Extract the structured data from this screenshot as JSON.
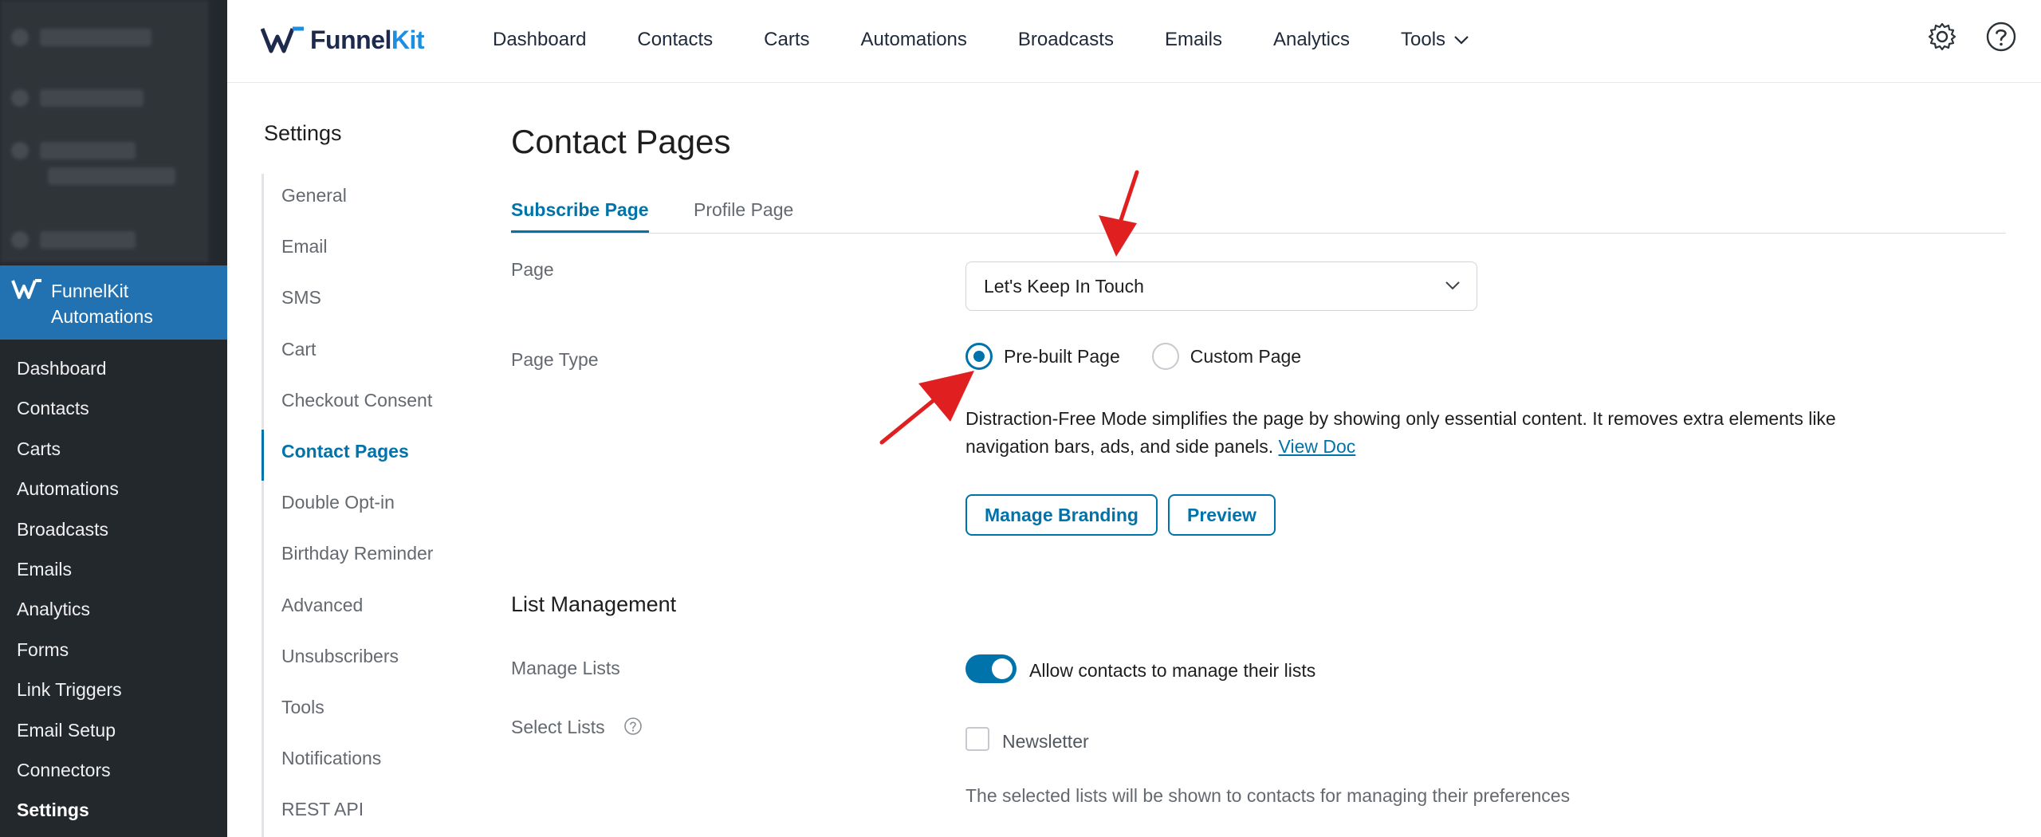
{
  "wp_sidebar": {
    "active_plugin": {
      "line1": "FunnelKit",
      "line2": "Automations"
    },
    "items": [
      {
        "label": "Dashboard"
      },
      {
        "label": "Contacts"
      },
      {
        "label": "Carts"
      },
      {
        "label": "Automations"
      },
      {
        "label": "Broadcasts"
      },
      {
        "label": "Emails"
      },
      {
        "label": "Analytics"
      },
      {
        "label": "Forms"
      },
      {
        "label": "Link Triggers"
      },
      {
        "label": "Email Setup"
      },
      {
        "label": "Connectors"
      },
      {
        "label": "Settings",
        "active": true
      }
    ]
  },
  "header": {
    "logo": {
      "part1": "Funnel",
      "part2": "Kit"
    },
    "nav": [
      {
        "label": "Dashboard"
      },
      {
        "label": "Contacts"
      },
      {
        "label": "Carts"
      },
      {
        "label": "Automations"
      },
      {
        "label": "Broadcasts"
      },
      {
        "label": "Emails"
      },
      {
        "label": "Analytics"
      },
      {
        "label": "Tools",
        "has_dropdown": true
      }
    ],
    "icons": [
      "gear-icon",
      "help-icon"
    ]
  },
  "settings_nav": {
    "title": "Settings",
    "items": [
      {
        "label": "General"
      },
      {
        "label": "Email"
      },
      {
        "label": "SMS"
      },
      {
        "label": "Cart"
      },
      {
        "label": "Checkout Consent"
      },
      {
        "label": "Contact Pages",
        "active": true
      },
      {
        "label": "Double Opt-in"
      },
      {
        "label": "Birthday Reminder"
      },
      {
        "label": "Advanced"
      },
      {
        "label": "Unsubscribers"
      },
      {
        "label": "Tools"
      },
      {
        "label": "Notifications"
      },
      {
        "label": "REST API"
      }
    ]
  },
  "main": {
    "title": "Contact Pages",
    "tabs": [
      {
        "label": "Subscribe Page",
        "active": true
      },
      {
        "label": "Profile Page"
      }
    ],
    "page_field": {
      "label": "Page",
      "value": "Let's Keep In Touch"
    },
    "page_type": {
      "label": "Page Type",
      "options": [
        {
          "label": "Pre-built Page",
          "checked": true
        },
        {
          "label": "Custom Page",
          "checked": false
        }
      ]
    },
    "description": "Distraction-Free Mode simplifies the page by showing only essential content. It removes extra elements like navigation bars, ads, and side panels.",
    "view_doc_link": "View Doc",
    "buttons": {
      "manage_branding": "Manage Branding",
      "preview": "Preview"
    },
    "list_management": {
      "title": "List Management",
      "manage_lists_label": "Manage Lists",
      "toggle_label": "Allow contacts to manage their lists",
      "toggle_on": true,
      "select_lists_label": "Select Lists",
      "list_option": "Newsletter",
      "hint": "The selected lists will be shown to contacts for managing their preferences"
    }
  },
  "colors": {
    "accent": "#0073aa",
    "wp_sidebar_bg": "#23282d",
    "wp_active_bg": "#2271b1",
    "annotation_arrow": "#e02020"
  }
}
